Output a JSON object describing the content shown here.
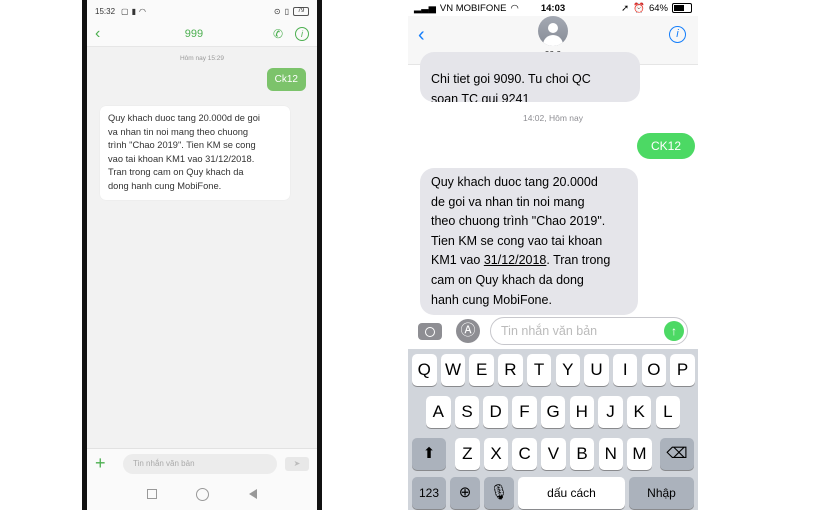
{
  "android": {
    "status": {
      "time": "15:32",
      "battery": "79"
    },
    "header": {
      "title": "999"
    },
    "date_label": "Hôm nay 15:29",
    "sent_message": "Ck12",
    "received_message": "Quy khach duoc tang 20.000d de goi\nva nhan tin noi mang theo chuong\ntrình \"Chao 2019\". Tien KM se cong\nvao tai khoan KM1 vao 31/12/2018.\nTran trong cam on Quy khach da\ndong hanh cung MobiFone.",
    "input_placeholder": "Tin nhắn văn bản"
  },
  "ios": {
    "status": {
      "carrier": "VN MOBIFONE",
      "time": "14:03",
      "battery": "64%"
    },
    "contact_name": "99 9",
    "previous_message": "Chi tiet goi 9090. Tu choi QC\nsoan TC gui 9241",
    "date_label": "14:02, Hôm nay",
    "sent_message": "CK12",
    "received_message_part1": "Quy khach duoc tang 20.000d\nde goi va nhan tin noi mang\ntheo chuong trình \"Chao 2019\".\nTien KM se cong vao tai khoan\nKM1 vao ",
    "received_date_link": "31/12/2018",
    "received_message_part2": ". Tran trong\ncam on Quy khach da dong\nhanh cung MobiFone.",
    "input_placeholder": "Tin nhắn văn bản",
    "keyboard": {
      "row1": [
        "Q",
        "W",
        "E",
        "R",
        "T",
        "Y",
        "U",
        "I",
        "O",
        "P"
      ],
      "row2": [
        "A",
        "S",
        "D",
        "F",
        "G",
        "H",
        "J",
        "K",
        "L"
      ],
      "row3": [
        "Z",
        "X",
        "C",
        "V",
        "B",
        "N",
        "M"
      ],
      "numbers_key": "123",
      "space_key": "dấu cách",
      "return_key": "Nhập"
    }
  },
  "colors": {
    "android_accent": "#4caf50",
    "android_sent_bubble": "#7cc36b",
    "ios_blue": "#147efb",
    "ios_green": "#4cd964",
    "ios_gray_bubble": "#e5e5ea"
  }
}
